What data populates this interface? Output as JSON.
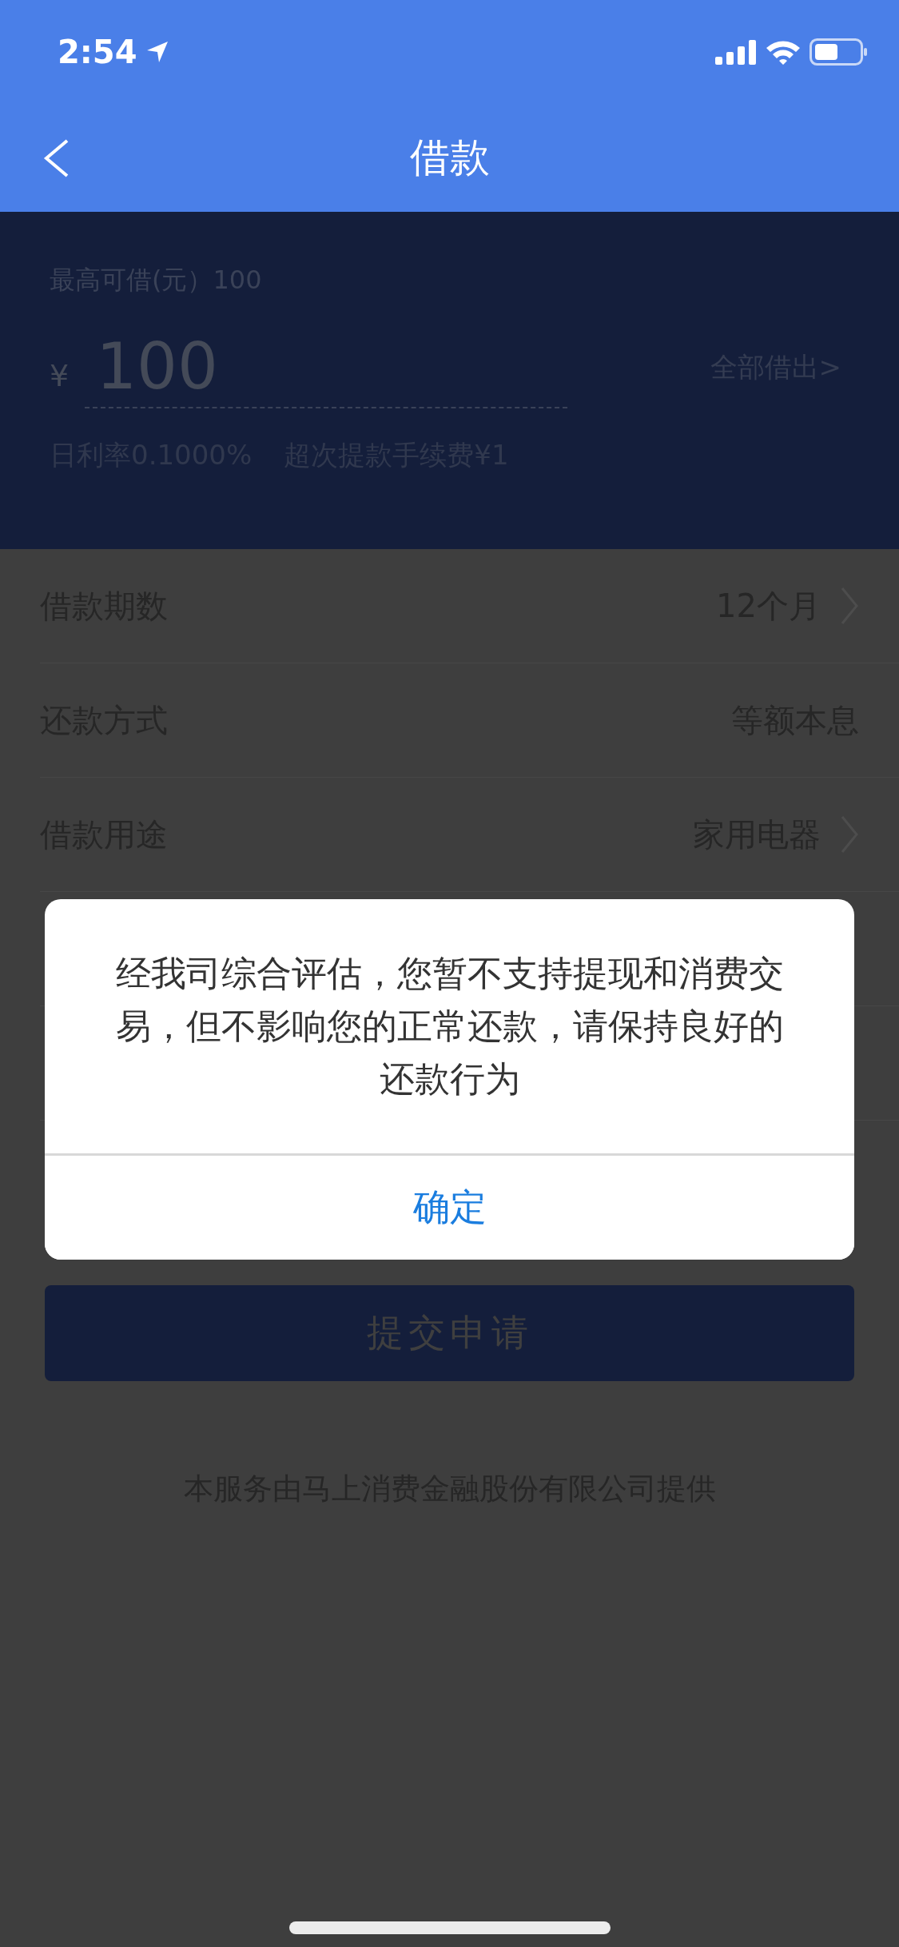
{
  "status_bar": {
    "time": "2:54"
  },
  "nav": {
    "title": "借款"
  },
  "loan": {
    "limit_label": "最高可借(元）100",
    "currency": "¥",
    "amount": "100",
    "borrow_all": "全部借出>",
    "rate": "日利率0.1000%",
    "fee": "超次提款手续费¥1"
  },
  "rows": [
    {
      "label": "借款期数",
      "value": "12个月",
      "chevron": true
    },
    {
      "label": "还款方式",
      "value": "等额本息",
      "chevron": false
    },
    {
      "label": "借款用途",
      "value": "家用电器",
      "chevron": true
    }
  ],
  "submit": {
    "label": "提交申请"
  },
  "footer": "本服务由马上消费金融股份有限公司提供",
  "dialog": {
    "message": "经我司综合评估，您暂不支持提现和消费交易，但不影响您的正常还款，请保持良好的还款行为",
    "button": "确定"
  }
}
